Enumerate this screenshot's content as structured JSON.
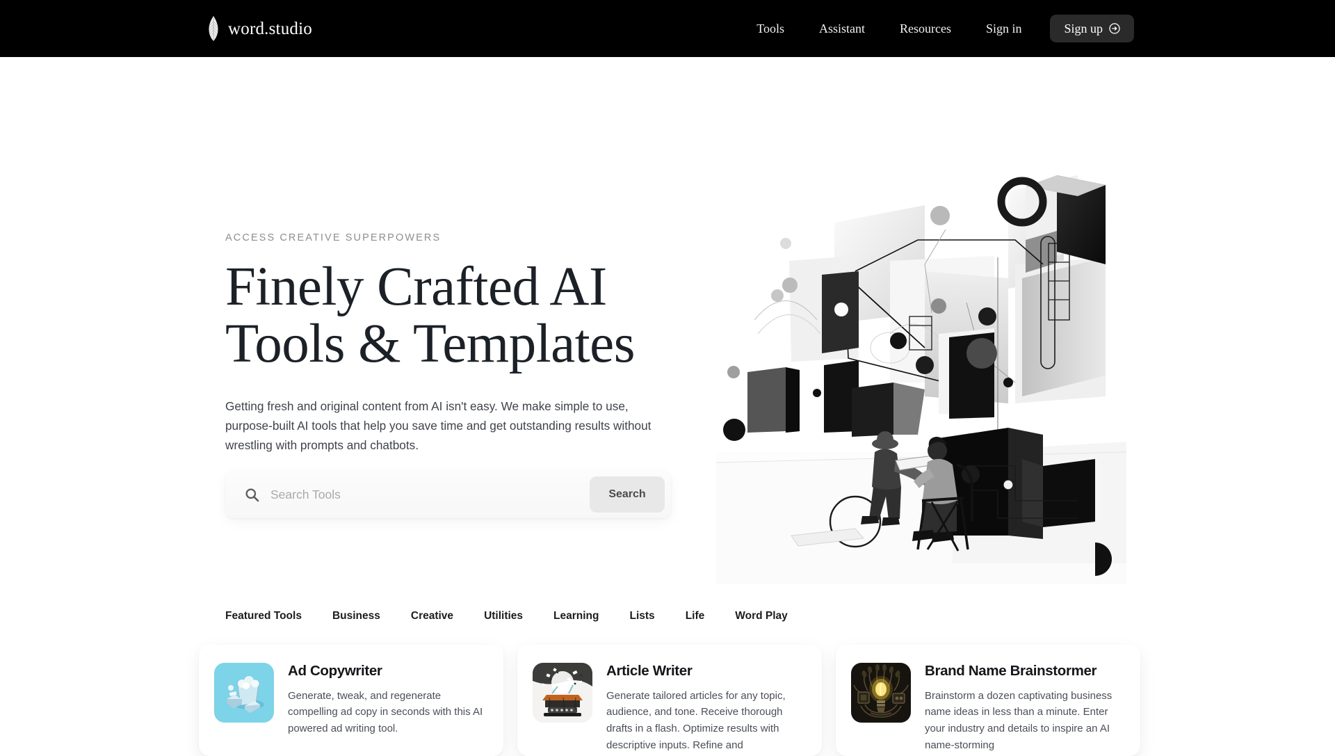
{
  "header": {
    "brand": {
      "name": "word.studio",
      "icon": "feather-quill-icon"
    },
    "nav_links": [
      {
        "label": "Tools"
      },
      {
        "label": "Assistant"
      },
      {
        "label": "Resources"
      },
      {
        "label": "Sign in"
      }
    ],
    "signup": {
      "label": "Sign up",
      "icon": "arrow-right-circle-icon"
    }
  },
  "hero": {
    "eyebrow": "ACCESS CREATIVE SUPERPOWERS",
    "title_line1": "Finely Crafted AI",
    "title_line2": "Tools & Templates",
    "subtitle": "Getting fresh and original content from AI isn't easy. We make  simple to use, purpose-built AI tools that help you save time and get outstanding results without wrestling with prompts and chatbots.",
    "search": {
      "placeholder": "Search Tools",
      "value": "",
      "button_label": "Search",
      "icon": "search-icon"
    },
    "artwork": {
      "name": "abstract-geometric-collage-illustration",
      "description": "Monochrome abstract composition of cubes, circles, lines and two seated figures working together"
    }
  },
  "tabs": [
    {
      "label": "Featured Tools",
      "active": true
    },
    {
      "label": "Business",
      "active": false
    },
    {
      "label": "Creative",
      "active": false
    },
    {
      "label": "Utilities",
      "active": false
    },
    {
      "label": "Learning",
      "active": false
    },
    {
      "label": "Lists",
      "active": false
    },
    {
      "label": "Life",
      "active": false
    },
    {
      "label": "Word Play",
      "active": false
    }
  ],
  "cards": [
    {
      "title": "Ad Copywriter",
      "description": "Generate, tweak, and regenerate compelling ad copy in seconds with this AI powered ad writing tool.",
      "thumb_name": "ad-copywriter-thumbnail",
      "thumb_bg": "#7dd3e8"
    },
    {
      "title": "Article Writer",
      "description": "Generate tailored articles for any topic, audience, and tone. Receive thorough drafts in a flash. Optimize results with descriptive inputs. Refine and",
      "thumb_name": "article-writer-thumbnail",
      "thumb_bg": "#f2f2f0"
    },
    {
      "title": "Brand Name Brainstormer",
      "description": "Brainstorm a dozen captivating business name ideas in less than a minute. Enter your industry and details to inspire an AI name-storming",
      "thumb_name": "brand-name-brainstormer-thumbnail",
      "thumb_bg": "#1a1712"
    }
  ],
  "colors": {
    "header_bg": "#000000",
    "page_bg": "#ffffff",
    "heading": "#1c2127",
    "body_text": "#3f434a",
    "muted": "#8e8e93",
    "signup_bg": "#2a2a2a",
    "search_btn_bg": "#e8e8e9"
  }
}
